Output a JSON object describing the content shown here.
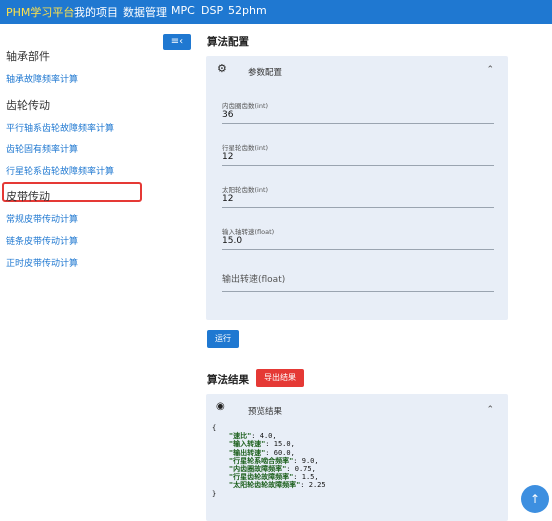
{
  "topbar": {
    "brand": "PHM学习平台",
    "nav": [
      "我的项目",
      "数据管理",
      "MPC",
      "DSP",
      "52phm"
    ]
  },
  "sidebar": {
    "groups": [
      {
        "title": "轴承部件",
        "items": [
          "轴承故障频率计算"
        ]
      },
      {
        "title": "齿轮传动",
        "items": [
          "平行轴系齿轮故障频率计算",
          "齿轮固有频率计算",
          "行星轮系齿轮故障频率计算"
        ]
      },
      {
        "title": "皮带传动",
        "items": [
          "常规皮带传动计算",
          "链条皮带传动计算",
          "正时皮带传动计算"
        ]
      }
    ],
    "active_item": "行星轮系齿轮故障频率计算"
  },
  "config": {
    "section_title": "算法配置",
    "panel_title": "参数配置",
    "fields": [
      {
        "label": "内齿圈齿数(int)",
        "value": "36"
      },
      {
        "label": "行星轮齿数(int)",
        "value": "12"
      },
      {
        "label": "太阳轮齿数(int)",
        "value": "12"
      },
      {
        "label": "输入轴转速(float)",
        "value": "15.0"
      }
    ],
    "output_placeholder": "输出转速(float)",
    "run_label": "运行"
  },
  "results": {
    "section_title": "算法结果",
    "export_label": "导出结果",
    "panel_title": "预览结果",
    "open_brace": "{",
    "close_brace": "}",
    "entries": [
      {
        "key": "\"速比\"",
        "value": ": 4.0,"
      },
      {
        "key": "\"输入转速\"",
        "value": ": 15.0,"
      },
      {
        "key": "\"输出转速\"",
        "value": ": 60.0,"
      },
      {
        "key": "\"行星轮系啮合频率\"",
        "value": ": 9.0,"
      },
      {
        "key": "\"内齿圈故障频率\"",
        "value": ": 0.75,"
      },
      {
        "key": "\"行星齿轮故障频率\"",
        "value": ": 1.5,"
      },
      {
        "key": "\"太阳轮齿轮故障频率\"",
        "value": ": 2.25"
      }
    ]
  },
  "colors": {
    "primary": "#1f78d1",
    "danger": "#e53935",
    "brand_text": "#ffe24a",
    "panel_bg": "#e8eef7"
  },
  "icons": {
    "toggle": "menu-collapse-icon",
    "settings": "gear-icon",
    "preview": "eye-icon",
    "chevron": "chevron-up-icon",
    "fab": "arrow-up-icon"
  }
}
